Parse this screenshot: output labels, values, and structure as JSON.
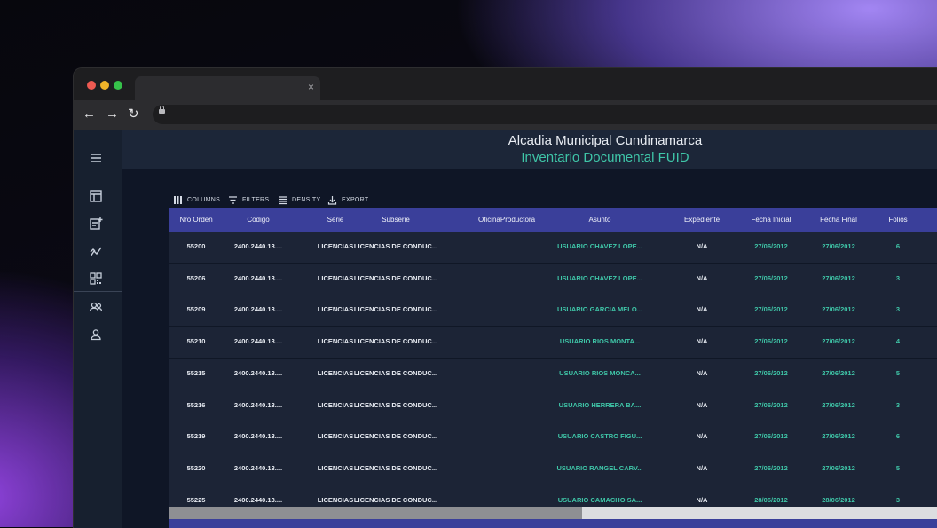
{
  "app": {
    "title": "Alcadia Municipal Cundinamarca",
    "subtitle": "Inventario Documental FUID"
  },
  "toolbar": {
    "columns": "COLUMNS",
    "filters": "FILTERS",
    "density": "DENSITY",
    "export": "EXPORT"
  },
  "sidebar": {
    "icons": [
      "menu-icon",
      "table-icon",
      "add-note-icon",
      "chart-icon",
      "qr-code-icon",
      "users-icon",
      "user-icon"
    ]
  },
  "grid": {
    "columns": [
      "Nro Orden",
      "Codigo",
      "Serie",
      "Subserie",
      "OficinaProductora",
      "Asunto",
      "Expediente",
      "Fecha Inicial",
      "Fecha Final",
      "Folios"
    ],
    "rows": [
      [
        "55200",
        "2400.2440.13....",
        "LICENCIAS",
        "LICENCIAS DE CONDUC...",
        "",
        "USUARIO CHAVEZ LOPE...",
        "N/A",
        "27/06/2012",
        "27/06/2012",
        "6"
      ],
      [
        "55206",
        "2400.2440.13....",
        "LICENCIAS",
        "LICENCIAS DE CONDUC...",
        "",
        "USUARIO CHAVEZ LOPE...",
        "N/A",
        "27/06/2012",
        "27/06/2012",
        "3"
      ],
      [
        "55209",
        "2400.2440.13....",
        "LICENCIAS",
        "LICENCIAS DE CONDUC...",
        "",
        "USUARIO GARCIA MELO...",
        "N/A",
        "27/06/2012",
        "27/06/2012",
        "3"
      ],
      [
        "55210",
        "2400.2440.13....",
        "LICENCIAS",
        "LICENCIAS DE CONDUC...",
        "",
        "USUARIO RIOS MONTA...",
        "N/A",
        "27/06/2012",
        "27/06/2012",
        "4"
      ],
      [
        "55215",
        "2400.2440.13....",
        "LICENCIAS",
        "LICENCIAS DE CONDUC...",
        "",
        "USUARIO RIOS MONCA...",
        "N/A",
        "27/06/2012",
        "27/06/2012",
        "5"
      ],
      [
        "55216",
        "2400.2440.13....",
        "LICENCIAS",
        "LICENCIAS DE CONDUC...",
        "",
        "USUARIO HERRERA BA...",
        "N/A",
        "27/06/2012",
        "27/06/2012",
        "3"
      ],
      [
        "55219",
        "2400.2440.13....",
        "LICENCIAS",
        "LICENCIAS DE CONDUC...",
        "",
        "USUARIO CASTRO FIGU...",
        "N/A",
        "27/06/2012",
        "27/06/2012",
        "6"
      ],
      [
        "55220",
        "2400.2440.13....",
        "LICENCIAS",
        "LICENCIAS DE CONDUC...",
        "",
        "USUARIO RANGEL CARV...",
        "N/A",
        "27/06/2012",
        "27/06/2012",
        "5"
      ],
      [
        "55225",
        "2400.2440.13....",
        "LICENCIAS",
        "LICENCIAS DE CONDUC...",
        "",
        "USUARIO CAMACHO SA...",
        "N/A",
        "28/06/2012",
        "28/06/2012",
        "3"
      ]
    ],
    "horizontal_scroll_position": 0
  },
  "colors": {
    "accent_teal": "#3fc6a8",
    "header_indigo": "#3a3f9a",
    "background": "#141d2e"
  }
}
